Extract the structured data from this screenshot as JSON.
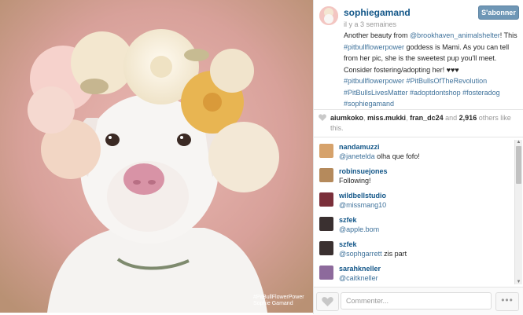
{
  "photo": {
    "watermark_line1": "#PitBullFlowerPower",
    "watermark_line2": "Sophie Gamand"
  },
  "header": {
    "username": "sophiegamand",
    "time_ago": "il y a 3 semaines",
    "follow_label": "S'abonner"
  },
  "caption": {
    "text1": "Another beauty from ",
    "link1": "@brookhaven_animalshelter",
    "text2": "! This ",
    "link2": "#pitbullflowerpower",
    "text3": " goddess is Mami. As you can tell from her pic, she is the sweetest pup you'll meet. Consider fostering/adopting her! ",
    "hearts": "♥♥♥",
    "tags": "#pitbullflowerpower #PitBullsOfTheRevolution #PitBullsLivesMatter #adoptdontshop #fosteradog #sophiegamand"
  },
  "likes": {
    "user1": "aiumkoko",
    "user2": "miss.mukki",
    "user3": "fran_dc24",
    "and": "and",
    "count": "2,916",
    "suffix": "others like this."
  },
  "comments": [
    {
      "user": "nandamuzzi",
      "mention": "@janetelda",
      "text": " olha que fofo!",
      "color": "#d6a26b"
    },
    {
      "user": "robinsuejones",
      "mention": "",
      "text": "Following!",
      "color": "#b58a5c"
    },
    {
      "user": "wildbellstudio",
      "mention": "@missmang10",
      "text": "",
      "color": "#7a2f3a"
    },
    {
      "user": "szfek",
      "mention": "@apple.bom",
      "text": "",
      "color": "#3a3030"
    },
    {
      "user": "szfek",
      "mention": "@sophgarrett",
      "text": " zis part",
      "color": "#3a3030"
    },
    {
      "user": "sarahkneller",
      "mention": "@caitkneller",
      "text": "",
      "color": "#8d6a9c"
    }
  ],
  "footer": {
    "comment_placeholder": "Commenter...",
    "more_label": "•••"
  },
  "colors": {
    "link": "#3f729b",
    "username": "#125688",
    "follow_button": "#6f97b6"
  },
  "icons": {
    "like": "heart-icon",
    "more": "ellipsis-icon"
  }
}
